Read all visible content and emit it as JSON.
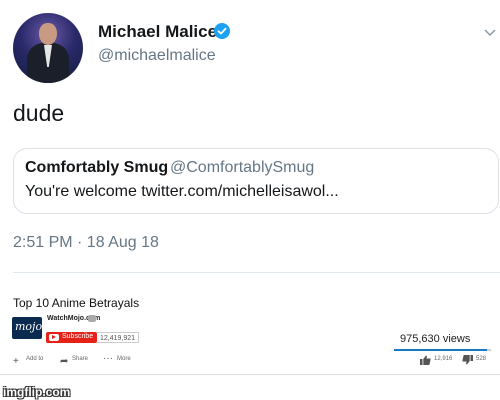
{
  "tweet": {
    "author_name": "Michael Malice",
    "author_handle": "@michaelmalice",
    "text": "dude",
    "timestamp": "2:51 PM · 18 Aug 18",
    "verified_color": "#1da1f2",
    "menu_icon": "chevron-down-icon"
  },
  "quoted_tweet": {
    "author_name": "Comfortably Smug",
    "author_handle": "@ComfortablySmug",
    "text": "You're welcome twitter.com/michelleisawol..."
  },
  "youtube": {
    "video_title": "Top 10 Anime Betrayals",
    "channel_logo_text": "mojo",
    "channel_name": "WatchMojo.com",
    "subscribe_label": "Subscribe",
    "subscriber_count": "12,419,921",
    "views": "975,630 views",
    "add_to_label": "Add to",
    "share_label": "Share",
    "more_label": "More",
    "likes": "12,916",
    "dislikes": "528",
    "like_ratio": 0.96,
    "accent_color": "#e62117"
  },
  "watermark": "imgflip.com"
}
